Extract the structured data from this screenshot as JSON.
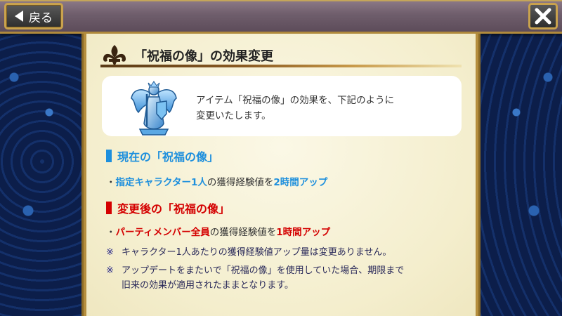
{
  "topbar": {
    "back_label": "戻る",
    "close_icon": "close-icon"
  },
  "panel": {
    "title": "「祝福の像」の効果変更",
    "item": {
      "icon": "angel-statue-icon",
      "desc_line1": "アイテム「祝福の像」の効果を、下記のように",
      "desc_line2": "変更いたします。"
    },
    "current": {
      "heading": "現在の「祝福の像」",
      "bullet": "・",
      "target": "指定キャラクター1人",
      "middle": "の獲得経験値を",
      "amount": "2時間アップ"
    },
    "changed": {
      "heading": "変更後の「祝福の像」",
      "bullet": "・",
      "target": "パーティメンバー全員",
      "middle": "の獲得経験値を",
      "amount": "1時間アップ"
    },
    "notes": [
      {
        "mark": "※",
        "line1": "キャラクター1人あたりの獲得経験値アップ量は変更ありません。"
      },
      {
        "mark": "※",
        "line1": "アップデートをまたいで「祝福の像」を使用していた場合、期限まで",
        "line2": "旧来の効果が適用されたままとなります。"
      }
    ]
  },
  "colors": {
    "accent_blue": "#1d8fdd",
    "accent_red": "#d40000",
    "gold_border": "#c9a24d",
    "parchment": "#f7f3da"
  }
}
